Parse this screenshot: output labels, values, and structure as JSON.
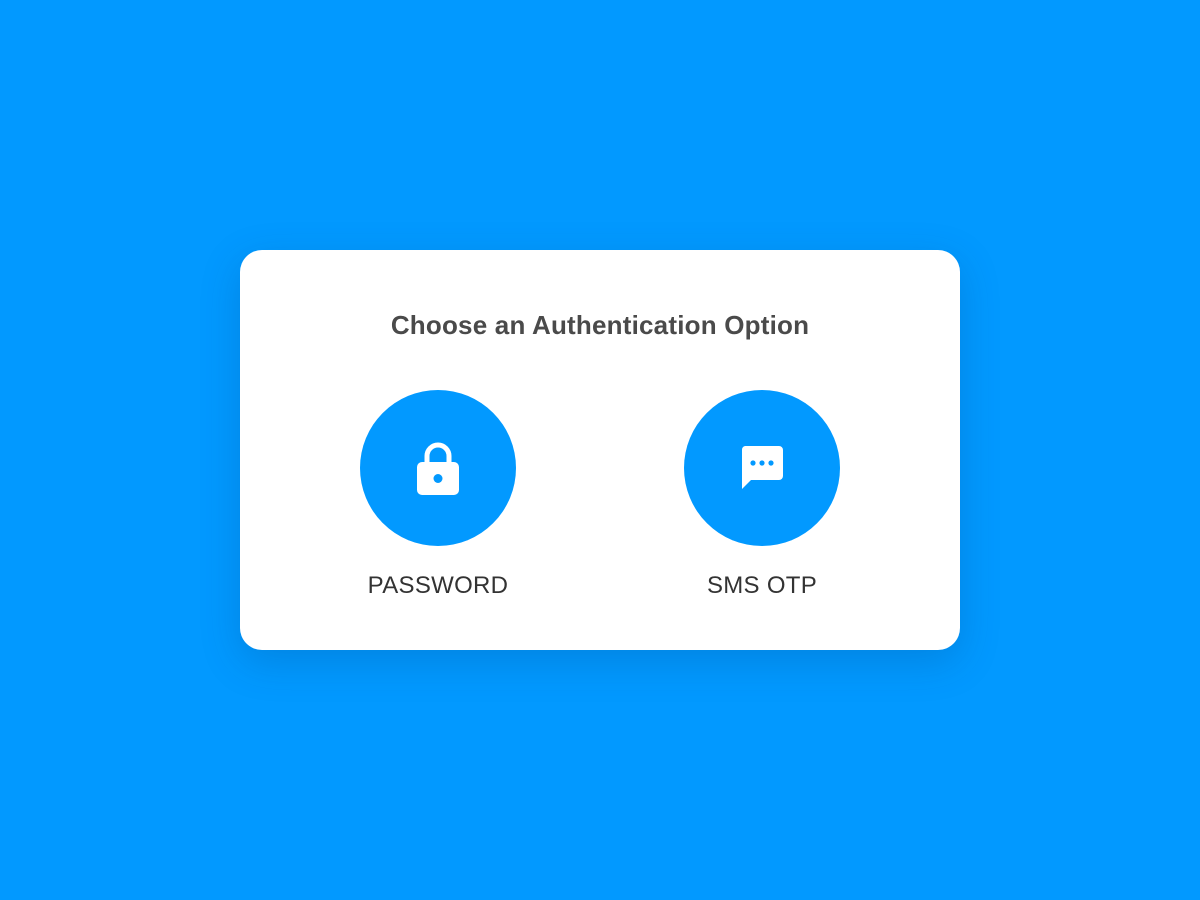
{
  "dialog": {
    "title": "Choose an Authentication Option",
    "options": [
      {
        "label": "PASSWORD",
        "icon": "lock-icon"
      },
      {
        "label": "SMS OTP",
        "icon": "sms-chat-icon"
      }
    ]
  },
  "colors": {
    "background": "#0299ff",
    "card": "#ffffff",
    "accent": "#0299ff",
    "title_text": "#4a4a4a",
    "label_text": "#333333"
  }
}
